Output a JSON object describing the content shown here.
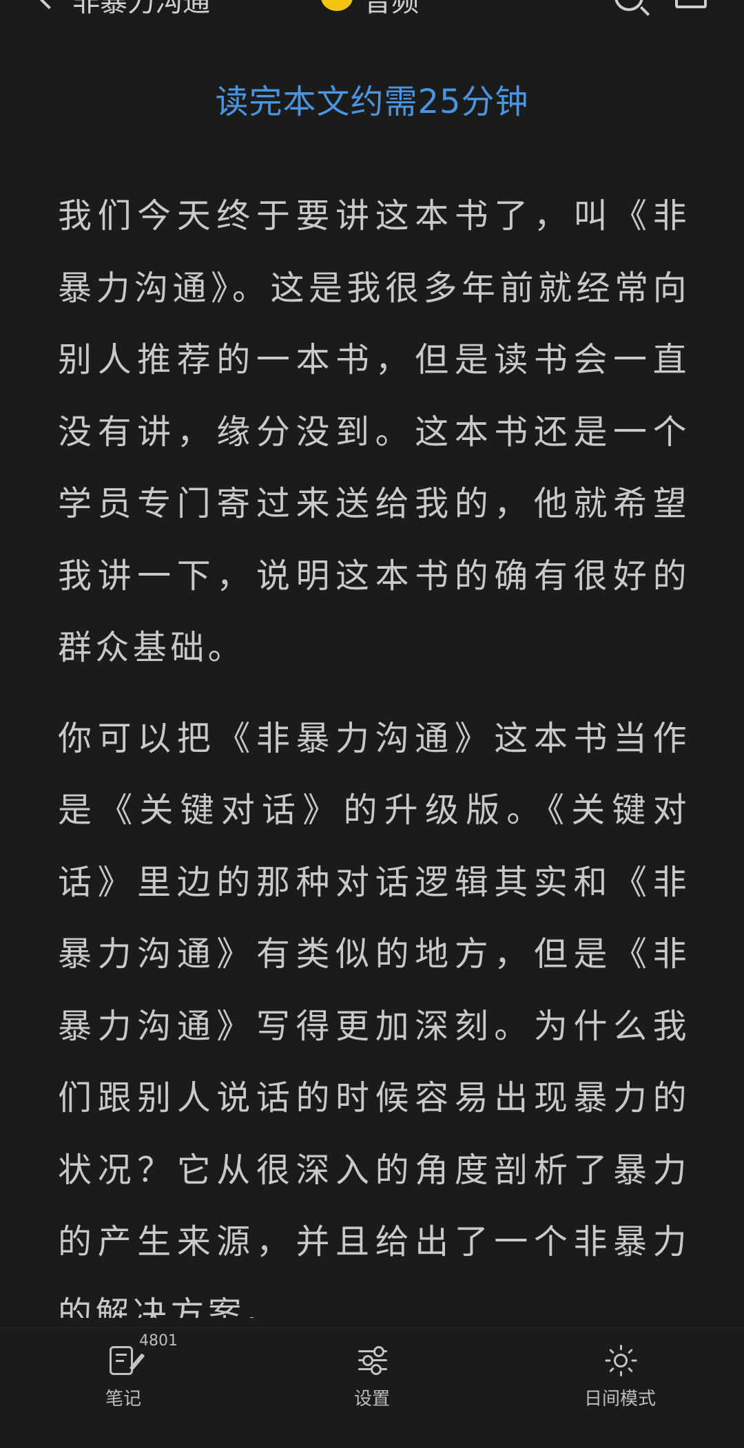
{
  "header": {
    "title_fragment": "非暴力沟通",
    "audio_label": "音频",
    "read_time": "读完本文约需25分钟"
  },
  "article": {
    "paragraphs": [
      "我们今天终于要讲这本书了，叫《非暴力沟通》。这是我很多年前就经常向别人推荐的一本书，但是读书会一直没有讲，缘分没到。这本书还是一个学员专门寄过来送给我的，他就希望我讲一下，说明这本书的确有很好的群众基础。",
      "你可以把《非暴力沟通》这本书当作是《关键对话》的升级版。《关键对话》里边的那种对话逻辑其实和《非暴力沟通》有类似的地方，但是《非暴力沟通》写得更加深刻。为什么我们跟别人说话的时候容易出现暴力的状况？它从很深入的角度剖析了暴力的产生来源，并且给出了一个非暴力的解决方案。"
    ]
  },
  "bottom_bar": {
    "notes_label": "笔记",
    "notes_count": "4801",
    "settings_label": "设置",
    "day_mode_label": "日间模式"
  },
  "colors": {
    "background": "#1b1b1b",
    "accent": "#4a95df",
    "text": "#c9c9c9"
  }
}
